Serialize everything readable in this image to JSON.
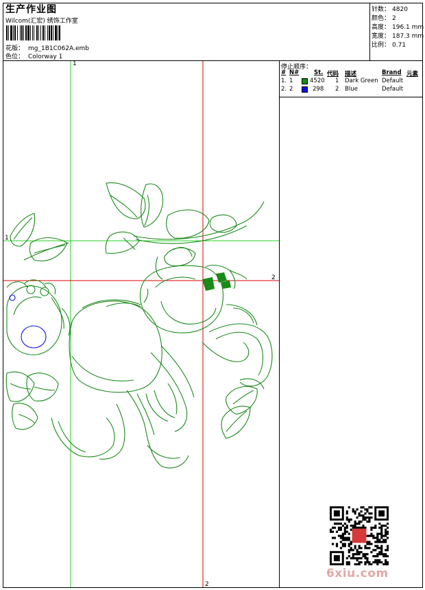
{
  "header": {
    "title": "生产作业图",
    "company": "Wilcom(汇宏) 绣饰工作室",
    "design_label": "花版：",
    "design_file": "mg_1B1C062A.emb",
    "colorway_label": "色位：",
    "colorway": "Colorway 1"
  },
  "stats": [
    {
      "label": "针数：",
      "value": "4820"
    },
    {
      "label": "颜色：",
      "value": "2"
    },
    {
      "label": "高度：",
      "value": "196.1 mm"
    },
    {
      "label": "宽度：",
      "value": "187.3 mm"
    },
    {
      "label": "比例：",
      "value": "0.71"
    }
  ],
  "stop_sequence": {
    "title": "停止顺序：",
    "columns": [
      "#",
      "N#",
      "St.",
      "代码",
      "描述",
      "Brand",
      "元素"
    ],
    "rows": [
      {
        "num": "1.",
        "needle": "1",
        "color": "#1a8a1a",
        "stitches": "4520",
        "code": "1",
        "description": "Dark Green",
        "brand": "Default"
      },
      {
        "num": "2.",
        "needle": "2",
        "color": "#1010dd",
        "stitches": "298",
        "code": "2",
        "description": "Blue",
        "brand": "Default"
      }
    ]
  },
  "guides": {
    "green_label": "1",
    "red_label": "2"
  },
  "colors": {
    "green_thread": "#1a8a1a",
    "blue_thread": "#1010dd",
    "green_guide": "#22cc22",
    "red_guide": "#dd0000",
    "watermark": "#e3a7a7"
  },
  "watermark": "6xiu.com"
}
